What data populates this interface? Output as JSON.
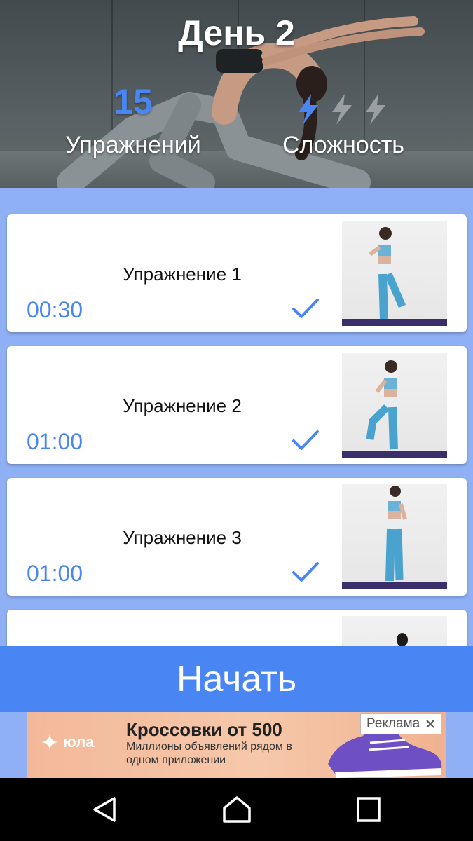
{
  "header": {
    "day_title": "День 2",
    "exercise_count": "15",
    "exercise_count_label": "Упражнений",
    "difficulty_label": "Сложность",
    "difficulty_level": 1,
    "difficulty_max": 3
  },
  "exercises": [
    {
      "title": "Упражнение 1",
      "duration": "00:30",
      "completed": true
    },
    {
      "title": "Упражнение 2",
      "duration": "01:00",
      "completed": true
    },
    {
      "title": "Упражнение 3",
      "duration": "01:00",
      "completed": true
    },
    {
      "title": "",
      "duration": "",
      "completed": false
    }
  ],
  "start_button": {
    "label": "Начать"
  },
  "ad": {
    "brand": "юла",
    "headline": "Кроссовки от 500",
    "subtext": "Миллионы объявлений рядом в одном приложении",
    "badge_label": "Реклама",
    "close_icon": "close-icon"
  },
  "navbar": {
    "icons": [
      "back-icon",
      "home-icon",
      "recents-icon"
    ]
  },
  "colors": {
    "accent": "#4a86f3",
    "list_background": "#8fb0f5",
    "card": "#ffffff"
  }
}
